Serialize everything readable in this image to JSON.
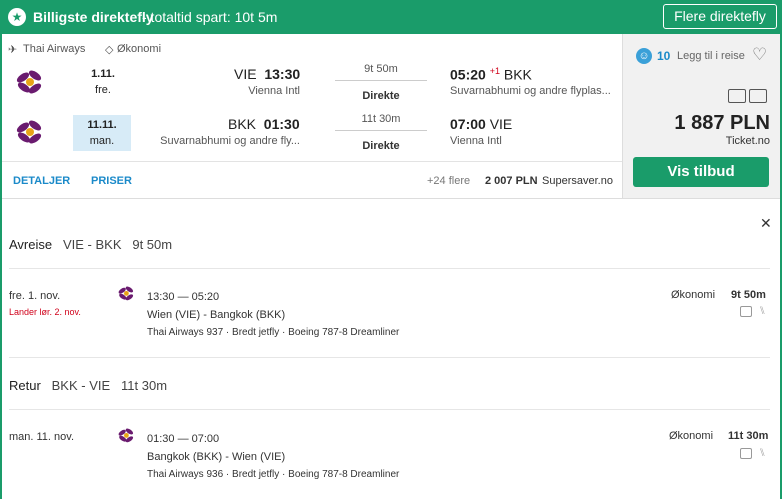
{
  "banner": {
    "star": "★",
    "title": "Billigste direktefly",
    "subtitle": " - totaltid spart: 10t 5m",
    "more_button": "Flere direktefly"
  },
  "result": {
    "airline_meta": "Thai Airways",
    "class_meta": "Økonomi",
    "outbound": {
      "date": "1.11.",
      "weekday": "fre.",
      "dep_code": "VIE",
      "dep_time": "13:30",
      "dep_place": "Vienna Intl",
      "duration": "9t 50m",
      "stops": "Direkte",
      "arr_time": "05:20",
      "arr_plus": "+1",
      "arr_code": "BKK",
      "arr_place": "Suvarnabhumi og andre flyplas..."
    },
    "inbound": {
      "date": "11.11.",
      "weekday": "man.",
      "dep_code": "BKK",
      "dep_time": "01:30",
      "dep_place": "Suvarnabhumi og andre fly...",
      "duration": "11t 30m",
      "stops": "Direkte",
      "arr_time": "07:00",
      "arr_code": "VIE",
      "arr_place": "Vienna Intl"
    },
    "links": {
      "details": "DETALJER",
      "prices": "PRISER"
    },
    "footer": {
      "more": "+24 flere",
      "alt_price": "2 007 PLN",
      "alt_vendor": "Supersaver.no"
    },
    "side": {
      "likes": "10",
      "add_label": "Legg til i reise",
      "price": "1 887 PLN",
      "vendor": "Ticket.no",
      "cta": "Vis tilbud"
    }
  },
  "details": {
    "outbound": {
      "label": "Avreise",
      "route": "VIE - BKK",
      "total": "9t 50m",
      "date": "fre. 1. nov.",
      "lands": "Lander lør. 2. nov.",
      "times": "13:30 — 05:20",
      "cities": "Wien (VIE) - Bangkok (BKK)",
      "flight": "Thai Airways 937 · Bredt jetfly · Boeing 787-8 Dreamliner",
      "cabin": "Økonomi",
      "duration": "9t 50m"
    },
    "inbound": {
      "label": "Retur",
      "route": "BKK - VIE",
      "total": "11t 30m",
      "date": "man. 11. nov.",
      "times": "01:30 — 07:00",
      "cities": "Bangkok (BKK) - Wien (VIE)",
      "flight": "Thai Airways 936 · Bredt jetfly · Boeing 787-8 Dreamliner",
      "cabin": "Økonomi",
      "duration": "11t 30m"
    }
  },
  "colors": {
    "brand": "#1a9c6a",
    "link": "#1b8ac9",
    "highlight": "#d7ebf7",
    "red": "#d0021b"
  }
}
